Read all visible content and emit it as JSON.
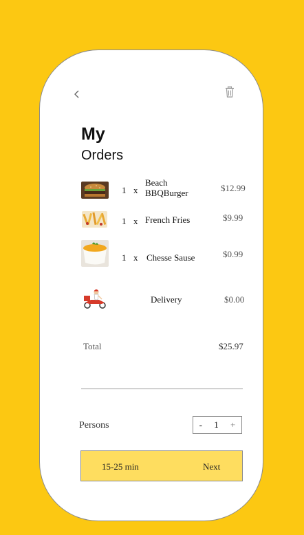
{
  "header": {
    "title_line1": "My",
    "title_line2": "Orders"
  },
  "icons": {
    "back": "chevron-left-icon",
    "delete": "trash-icon"
  },
  "colors": {
    "background": "#FCC812",
    "card": "#FFFFFF",
    "action_bar": "#FEDD5F"
  },
  "orders": [
    {
      "qty": "1",
      "x": "x",
      "name": "Beach BBQBurger",
      "price": "$12.99"
    },
    {
      "qty": "1",
      "x": "x",
      "name": "French Fries",
      "price": "$9.99"
    },
    {
      "qty": "1",
      "x": "x",
      "name": "Chesse Sause",
      "price": "$0.99"
    }
  ],
  "delivery": {
    "label": "Delivery",
    "price": "$0.00"
  },
  "total": {
    "label": "Total",
    "value": "$25.97"
  },
  "persons": {
    "label": "Persons",
    "decrement": "-",
    "value": "1",
    "increment": "+"
  },
  "footer": {
    "eta": "15-25 min",
    "next_label": "Next"
  }
}
